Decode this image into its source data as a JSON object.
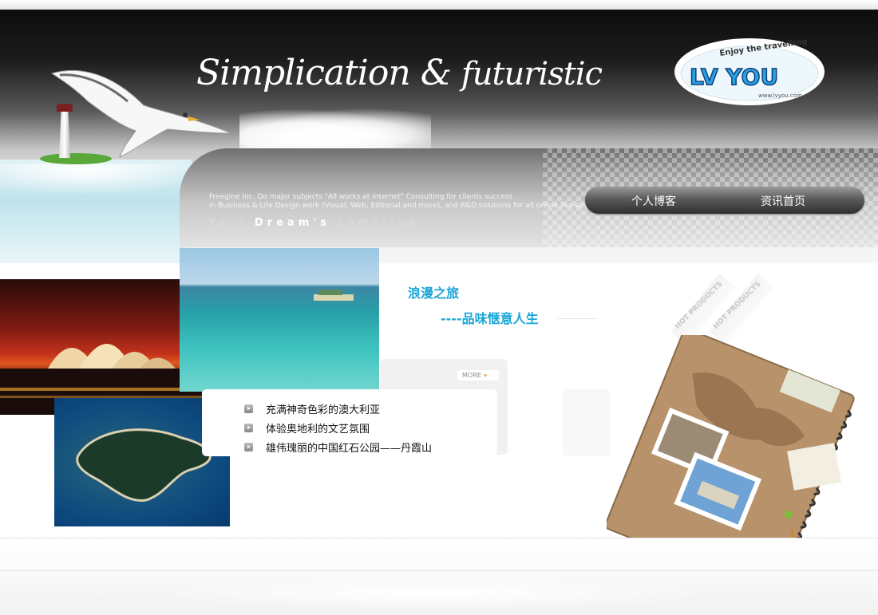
{
  "banner": {
    "title_main": "Simplication",
    "title_amp": "&",
    "title_second": "futuristic",
    "tagline_line1": "Freegine Inc. Do major subjects \"All works at internet\" Consulting for clients success",
    "tagline_line2": "in Business & Life Design work (Visual, Web, Editorial and more), and R&D solutions for all online live applications",
    "dream_prefix": "Your",
    "dream_word": "Dream's",
    "dream_suffix": "cometrue"
  },
  "logo": {
    "arc_text": "Enjoy the travelling",
    "brand": "LV YOU",
    "url": "www.lvyou.com"
  },
  "nav": {
    "items": [
      {
        "label": "个人博客"
      },
      {
        "label": "资讯首页"
      }
    ]
  },
  "content": {
    "heading1": "浪漫之旅",
    "heading2": "----品味惬意人生",
    "more_label": "MORE",
    "news": [
      {
        "title": "充满神奇色彩的澳大利亚"
      },
      {
        "title": "体验奥地利的文艺氛围"
      },
      {
        "title": "雄伟瑰丽的中国红石公园——丹霞山"
      }
    ],
    "hot_labels": [
      "HOT PRODUCTS",
      "HOT PRODUCTS"
    ]
  },
  "colors": {
    "accent": "#1aa6d6",
    "more_arrow": "#e08a1c"
  },
  "icons": [
    "seagull-icon",
    "lighthouse-icon",
    "bullet-arrow-icon",
    "more-arrow-icon"
  ]
}
